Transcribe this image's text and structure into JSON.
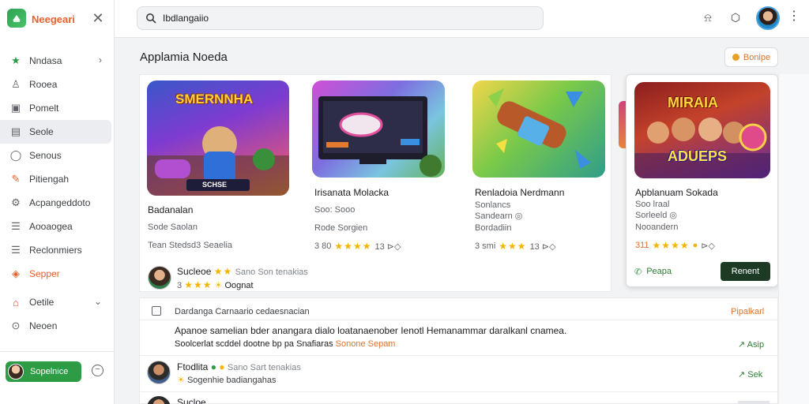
{
  "app": {
    "name": "Neegeari",
    "brand_color": "#e8612c",
    "accent_green": "#2e9b45"
  },
  "sidebar": {
    "items": [
      {
        "label": "Nndasa",
        "icon": "star-icon",
        "chevron": true
      },
      {
        "label": "Rooea",
        "icon": "person-icon"
      },
      {
        "label": "Pomelt",
        "icon": "inbox-icon"
      },
      {
        "label": "Seole",
        "icon": "doc-icon",
        "active": true
      },
      {
        "label": "Senous",
        "icon": "user-icon"
      },
      {
        "label": "Pitiengah",
        "icon": "pencil-icon"
      },
      {
        "label": "Acpangeddoto",
        "icon": "gear-icon"
      },
      {
        "label": "Aooaogea",
        "icon": "list-icon"
      },
      {
        "label": "Reclonmiers",
        "icon": "list-icon"
      },
      {
        "label": "Sepper",
        "icon": "tag-icon",
        "orange": true
      },
      {
        "label": "Oetile",
        "icon": "home-icon",
        "chevron": true
      },
      {
        "label": "Neoen",
        "icon": "compass-icon"
      }
    ],
    "bottom_button": "Sopelnice"
  },
  "header": {
    "search_value": "Ibdlangaiio",
    "search_placeholder": "Search"
  },
  "main": {
    "title": "Applamia Noeda",
    "top_button": "Bonipe"
  },
  "cards": [
    {
      "title": "Badanalan",
      "subtitle": "Sode Saolan",
      "meta": "Tean Stedsd3 Seaelia",
      "thumb_text": "SMERNNHA",
      "thumb_badge": "SCHSE"
    },
    {
      "title": "Irisanata Molacka",
      "subtitle": "Soo: Sooo",
      "meta": "Rode Sorgien",
      "rating": "3 80",
      "stars": "★★★★",
      "rating_suffix": "13 ⊳◇"
    },
    {
      "title": "Renladoia Nerdmann",
      "subtitle": "Sonlancs",
      "meta": "Sandearn ◎",
      "meta2": "Bordadiin",
      "rating": "3 smi",
      "stars": "★★★",
      "rating_suffix": "13 ⊳◇"
    }
  ],
  "featured": {
    "title": "Apblanuam Sokada",
    "subtitle": "Soo lraal",
    "meta": "Sorleeld ◎",
    "meta2": "Nooandern",
    "rating": "311",
    "stars": "★★★★",
    "thumb_text_top": "MIRAIA",
    "thumb_text_bottom": "ADUEPS",
    "button_secondary": "Peapa",
    "button_primary": "Renent"
  },
  "reviewer_top": {
    "name": "Sucleoe",
    "stars": "★★",
    "note": "Sano Son tenakias",
    "rating": "3",
    "stars2": "★★★",
    "label": "Oognat"
  },
  "list": {
    "header_label": "Dardanga Carnaario cedaesnacian",
    "header_action": "Pipalkarl",
    "body_line1": "Apanoe samelian bder anangara dialo loatanaenober Ienotl Hemanammar daralkanl cnamea.",
    "body_line2_prefix": "Soolcerlat scddel dootne bp pa Snafiaras",
    "body_line2_link": "Sonone Sepam",
    "row1_action": "Asip",
    "row2_name": "Ftodlita",
    "row2_note": "Sano Sart tenakias",
    "row2_sub": "Sogenhie badiangahas",
    "row2_action": "Sek",
    "row3_name": "Sucloe"
  }
}
